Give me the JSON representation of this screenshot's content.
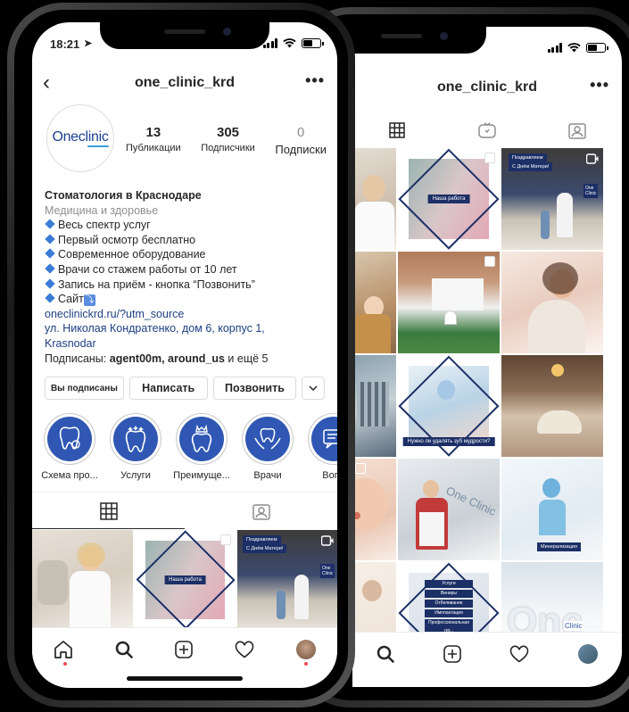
{
  "status": {
    "time": "18:21"
  },
  "profile": {
    "username": "one_clinic_krd",
    "avatar_text": "Oneclinic",
    "stats": [
      {
        "value": "13",
        "label": "Публикации"
      },
      {
        "value": "305",
        "label": "Подписчики"
      },
      {
        "value": "0",
        "label": "Подписки"
      }
    ],
    "bio": {
      "name": "Стоматология в Краснодаре",
      "category": "Медицина и здоровье",
      "lines": [
        "Весь спектр услуг",
        "Первый осмотр бесплатно",
        "Современное оборудование",
        "Врачи со стажем работы от 10 лет",
        "Запись на приём - кнопка “Позвонить”",
        "Сайт"
      ],
      "link": "oneclinickrd.ru/?utm_source",
      "address_line1": "ул. Николая Кондратенко, дом 6, корпус 1,",
      "address_line2": "Krasnodar",
      "followed_prefix": "Подписаны: ",
      "followed_names": "agent00m, around_us",
      "followed_suffix": " и ещё 5"
    }
  },
  "buttons": {
    "following": "Вы подписаны",
    "message": "Написать",
    "call": "Позвонить",
    "dropdown": "⌄"
  },
  "highlights": [
    {
      "label": "Схема про...",
      "icon": "tooth-location-icon"
    },
    {
      "label": "Услуги",
      "icon": "tooth-sparkle-icon"
    },
    {
      "label": "Преимуще...",
      "icon": "tooth-crown-icon"
    },
    {
      "label": "Врачи",
      "icon": "hands-tooth-icon"
    },
    {
      "label": "Вопр",
      "icon": "message-icon"
    }
  ],
  "posts": {
    "tag_work": "Наша работа",
    "tag_mother": "С Днём Матери!",
    "tag_congrats": "Поздравляем",
    "tag_wisdom": "Нужно ли удалять зуб мудрости?",
    "tag_mineral": "Минерализация",
    "tag_services": "Услуги",
    "tag_services_list": [
      "Виниры",
      "Отбеливание",
      "Имплантация",
      "Профессиональная гиг..."
    ],
    "logo": "One Clinic",
    "logo_short": "One Clinic"
  },
  "colors": {
    "brand": "#1c3f8f",
    "link": "#1e3f82",
    "accent": "#3a7bd5",
    "notification": "#ed4956"
  }
}
